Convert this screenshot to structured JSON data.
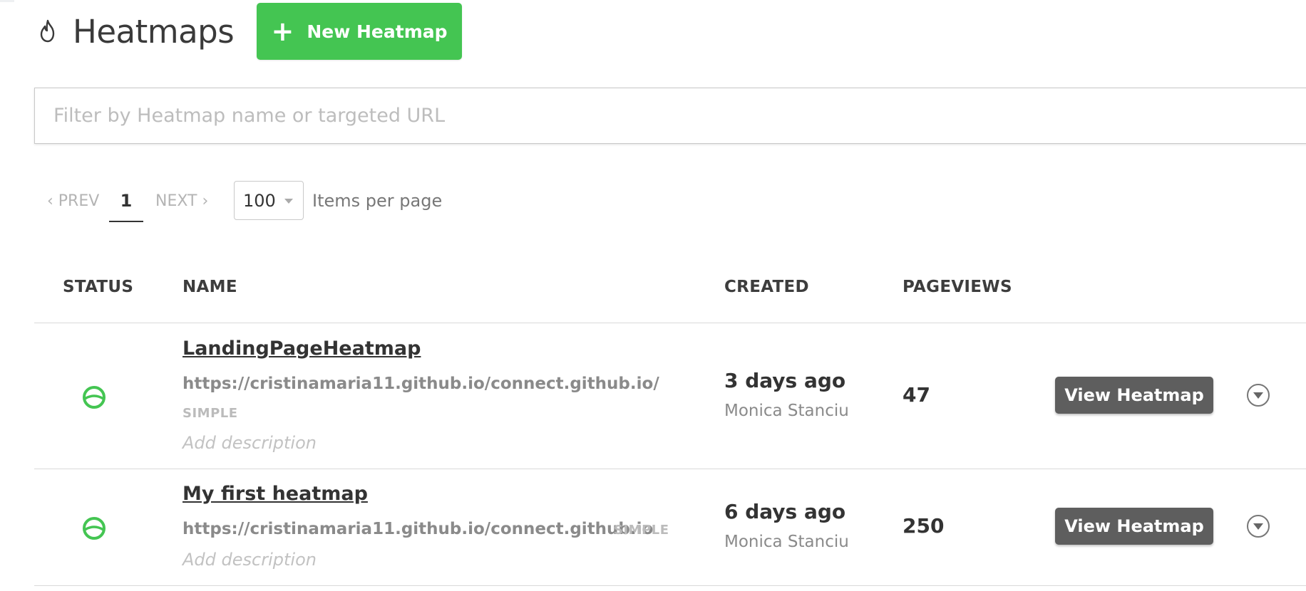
{
  "header": {
    "title": "Heatmaps",
    "new_button_label": "New Heatmap",
    "icon": "flame-icon"
  },
  "filter": {
    "placeholder": "Filter by Heatmap name or targeted URL",
    "value": ""
  },
  "pagination": {
    "prev_label": "‹ PREV",
    "current_page": "1",
    "next_label": "NEXT ›",
    "per_page_value": "100",
    "per_page_label": "Items per page"
  },
  "table": {
    "columns": [
      "STATUS",
      "NAME",
      "CREATED",
      "PAGEVIEWS"
    ],
    "rows": [
      {
        "status": "active",
        "name": "LandingPageHeatmap",
        "url": "https://cristinamaria11.github.io/connect.github.io/",
        "type": "SIMPLE",
        "description_placeholder": "Add description",
        "created": "3 days ago",
        "author": "Monica Stanciu",
        "pageviews": "47",
        "action_label": "View Heatmap"
      },
      {
        "status": "active",
        "name": "My first heatmap",
        "url": "https://cristinamaria11.github.io/connect.github.io",
        "type": "SIMPLE",
        "description_placeholder": "Add description",
        "created": "6 days ago",
        "author": "Monica Stanciu",
        "pageviews": "250",
        "action_label": "View Heatmap"
      }
    ]
  },
  "colors": {
    "primary_green": "#44c552",
    "status_green": "#44c552",
    "dark_button": "#5e5e5e"
  }
}
